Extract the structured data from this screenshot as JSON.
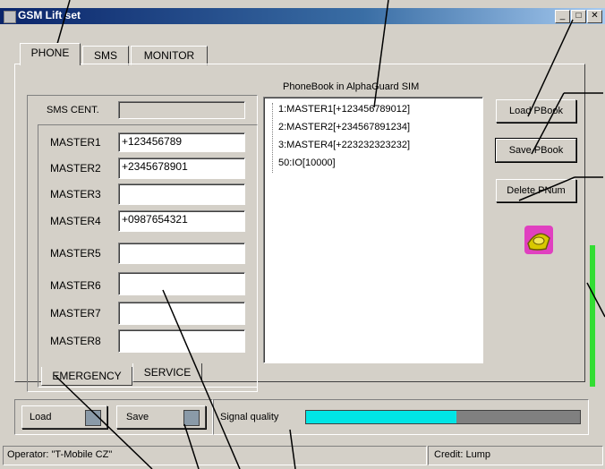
{
  "window": {
    "title": "GSM Lift set",
    "minimize_icon": "minimize-icon",
    "maximize_icon": "maximize-icon",
    "close_icon": "close-icon"
  },
  "tabs": [
    {
      "label": "PHONE"
    },
    {
      "label": "SMS"
    },
    {
      "label": "MONITOR"
    }
  ],
  "sms_center": {
    "label": "SMS CENT.",
    "value": ""
  },
  "masters": [
    {
      "label": "MASTER1",
      "value": "+123456789"
    },
    {
      "label": "MASTER2",
      "value": "+2345678901"
    },
    {
      "label": "MASTER3",
      "value": ""
    },
    {
      "label": "MASTER4",
      "value": "+0987654321"
    },
    {
      "label": "MASTER5",
      "value": ""
    },
    {
      "label": "MASTER6",
      "value": ""
    },
    {
      "label": "MASTER7",
      "value": ""
    },
    {
      "label": "MASTER8",
      "value": ""
    }
  ],
  "subtabs": [
    {
      "label": "EMERGENCY"
    },
    {
      "label": "SERVICE"
    }
  ],
  "phonebook": {
    "title": "PhoneBook in AlphaGuard SIM",
    "items": [
      "1:MASTER1[+123456789012]",
      "2:MASTER2[+234567891234]",
      "3:MASTER4[+223232323232]",
      "50:IO[10000]"
    ]
  },
  "buttons": {
    "load_pbook": "Load PBook",
    "save_pbook": "Save PBook",
    "delete_pnum": "Delete PNum",
    "load": "Load",
    "save": "Save"
  },
  "signal": {
    "label": "Signal quality",
    "level": 0.55,
    "level_color": "#00e5e5"
  },
  "status": {
    "operator": "Operator: \"T-Mobile CZ\"",
    "credit": "Credit: Lump"
  },
  "side_indicator_color": "#33dd33",
  "phone_icon": "phone-icon"
}
